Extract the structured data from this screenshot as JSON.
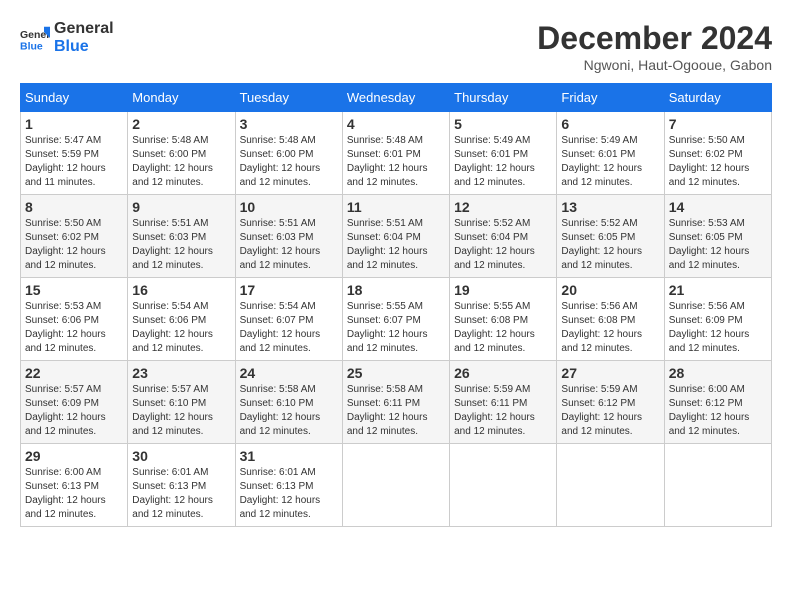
{
  "logo": {
    "line1": "General",
    "line2": "Blue"
  },
  "header": {
    "month": "December 2024",
    "location": "Ngwoni, Haut-Ogooue, Gabon"
  },
  "weekdays": [
    "Sunday",
    "Monday",
    "Tuesday",
    "Wednesday",
    "Thursday",
    "Friday",
    "Saturday"
  ],
  "weeks": [
    [
      {
        "day": "1",
        "sunrise": "5:47 AM",
        "sunset": "5:59 PM",
        "daylight": "12 hours and 11 minutes."
      },
      {
        "day": "2",
        "sunrise": "5:48 AM",
        "sunset": "6:00 PM",
        "daylight": "12 hours and 12 minutes."
      },
      {
        "day": "3",
        "sunrise": "5:48 AM",
        "sunset": "6:00 PM",
        "daylight": "12 hours and 12 minutes."
      },
      {
        "day": "4",
        "sunrise": "5:48 AM",
        "sunset": "6:01 PM",
        "daylight": "12 hours and 12 minutes."
      },
      {
        "day": "5",
        "sunrise": "5:49 AM",
        "sunset": "6:01 PM",
        "daylight": "12 hours and 12 minutes."
      },
      {
        "day": "6",
        "sunrise": "5:49 AM",
        "sunset": "6:01 PM",
        "daylight": "12 hours and 12 minutes."
      },
      {
        "day": "7",
        "sunrise": "5:50 AM",
        "sunset": "6:02 PM",
        "daylight": "12 hours and 12 minutes."
      }
    ],
    [
      {
        "day": "8",
        "sunrise": "5:50 AM",
        "sunset": "6:02 PM",
        "daylight": "12 hours and 12 minutes."
      },
      {
        "day": "9",
        "sunrise": "5:51 AM",
        "sunset": "6:03 PM",
        "daylight": "12 hours and 12 minutes."
      },
      {
        "day": "10",
        "sunrise": "5:51 AM",
        "sunset": "6:03 PM",
        "daylight": "12 hours and 12 minutes."
      },
      {
        "day": "11",
        "sunrise": "5:51 AM",
        "sunset": "6:04 PM",
        "daylight": "12 hours and 12 minutes."
      },
      {
        "day": "12",
        "sunrise": "5:52 AM",
        "sunset": "6:04 PM",
        "daylight": "12 hours and 12 minutes."
      },
      {
        "day": "13",
        "sunrise": "5:52 AM",
        "sunset": "6:05 PM",
        "daylight": "12 hours and 12 minutes."
      },
      {
        "day": "14",
        "sunrise": "5:53 AM",
        "sunset": "6:05 PM",
        "daylight": "12 hours and 12 minutes."
      }
    ],
    [
      {
        "day": "15",
        "sunrise": "5:53 AM",
        "sunset": "6:06 PM",
        "daylight": "12 hours and 12 minutes."
      },
      {
        "day": "16",
        "sunrise": "5:54 AM",
        "sunset": "6:06 PM",
        "daylight": "12 hours and 12 minutes."
      },
      {
        "day": "17",
        "sunrise": "5:54 AM",
        "sunset": "6:07 PM",
        "daylight": "12 hours and 12 minutes."
      },
      {
        "day": "18",
        "sunrise": "5:55 AM",
        "sunset": "6:07 PM",
        "daylight": "12 hours and 12 minutes."
      },
      {
        "day": "19",
        "sunrise": "5:55 AM",
        "sunset": "6:08 PM",
        "daylight": "12 hours and 12 minutes."
      },
      {
        "day": "20",
        "sunrise": "5:56 AM",
        "sunset": "6:08 PM",
        "daylight": "12 hours and 12 minutes."
      },
      {
        "day": "21",
        "sunrise": "5:56 AM",
        "sunset": "6:09 PM",
        "daylight": "12 hours and 12 minutes."
      }
    ],
    [
      {
        "day": "22",
        "sunrise": "5:57 AM",
        "sunset": "6:09 PM",
        "daylight": "12 hours and 12 minutes."
      },
      {
        "day": "23",
        "sunrise": "5:57 AM",
        "sunset": "6:10 PM",
        "daylight": "12 hours and 12 minutes."
      },
      {
        "day": "24",
        "sunrise": "5:58 AM",
        "sunset": "6:10 PM",
        "daylight": "12 hours and 12 minutes."
      },
      {
        "day": "25",
        "sunrise": "5:58 AM",
        "sunset": "6:11 PM",
        "daylight": "12 hours and 12 minutes."
      },
      {
        "day": "26",
        "sunrise": "5:59 AM",
        "sunset": "6:11 PM",
        "daylight": "12 hours and 12 minutes."
      },
      {
        "day": "27",
        "sunrise": "5:59 AM",
        "sunset": "6:12 PM",
        "daylight": "12 hours and 12 minutes."
      },
      {
        "day": "28",
        "sunrise": "6:00 AM",
        "sunset": "6:12 PM",
        "daylight": "12 hours and 12 minutes."
      }
    ],
    [
      {
        "day": "29",
        "sunrise": "6:00 AM",
        "sunset": "6:13 PM",
        "daylight": "12 hours and 12 minutes."
      },
      {
        "day": "30",
        "sunrise": "6:01 AM",
        "sunset": "6:13 PM",
        "daylight": "12 hours and 12 minutes."
      },
      {
        "day": "31",
        "sunrise": "6:01 AM",
        "sunset": "6:13 PM",
        "daylight": "12 hours and 12 minutes."
      },
      null,
      null,
      null,
      null
    ]
  ],
  "labels": {
    "sunrise": "Sunrise:",
    "sunset": "Sunset:",
    "daylight": "Daylight:"
  }
}
